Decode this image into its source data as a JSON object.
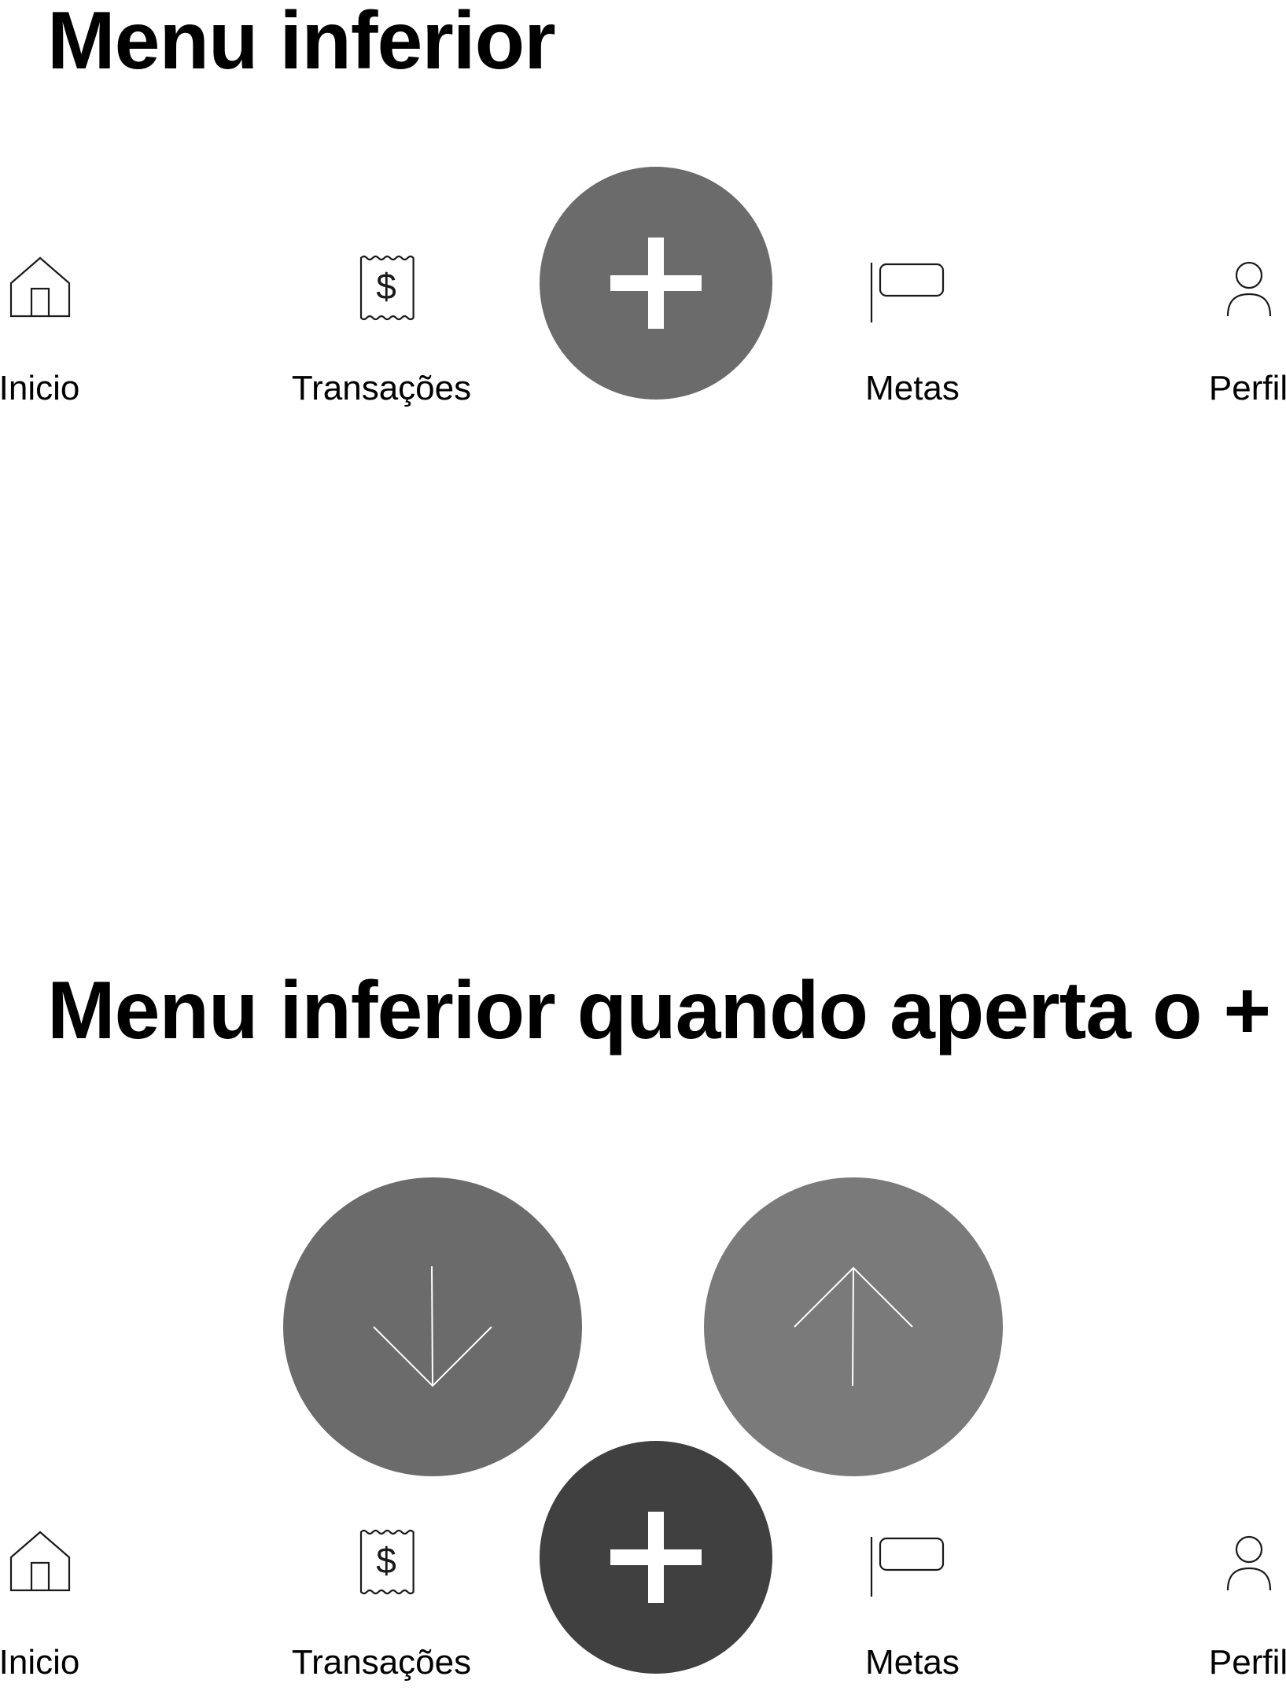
{
  "sections": [
    {
      "title": "Menu inferior",
      "nav_items": [
        {
          "label": "Inicio",
          "icon": "home-icon"
        },
        {
          "label": "Transações",
          "icon": "receipt-dollar-icon"
        },
        {
          "label": "Metas",
          "icon": "flag-icon"
        },
        {
          "label": "Perfil",
          "icon": "person-icon"
        }
      ],
      "fab": {
        "icon": "plus-icon",
        "color": "#6b6b6b"
      }
    },
    {
      "title": "Menu inferior quando aperta o +",
      "nav_items": [
        {
          "label": "Inicio",
          "icon": "home-icon"
        },
        {
          "label": "Transações",
          "icon": "receipt-dollar-icon"
        },
        {
          "label": "Metas",
          "icon": "flag-icon"
        },
        {
          "label": "Perfil",
          "icon": "person-icon"
        }
      ],
      "fab": {
        "icon": "plus-icon",
        "color": "#404040"
      },
      "expanded_actions": [
        {
          "icon": "arrow-down-icon",
          "color": "#6b6b6b"
        },
        {
          "icon": "arrow-up-icon",
          "color": "#7a7a7a"
        }
      ]
    }
  ],
  "colors": {
    "background": "#ffffff",
    "text": "#000000",
    "icon_stroke": "#1a1a1a"
  }
}
